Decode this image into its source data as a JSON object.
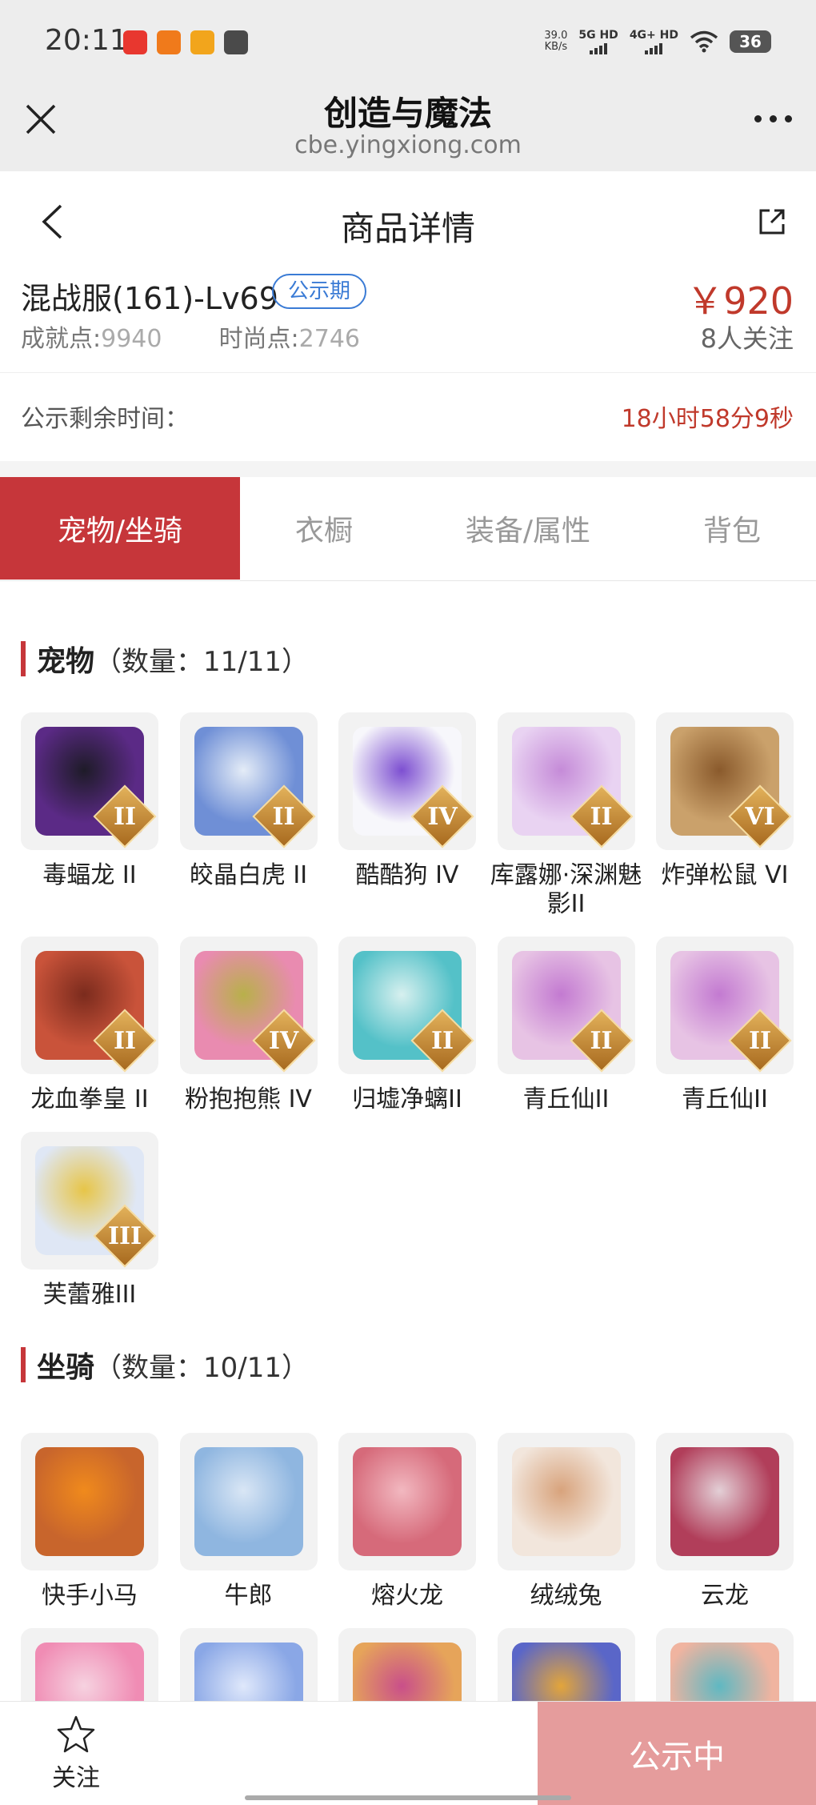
{
  "status_bar": {
    "time": "20:11",
    "net_speed_value": "39.0",
    "net_speed_unit": "KB/s",
    "signal_1": "5G HD",
    "signal_2": "4G+ HD",
    "battery": "36",
    "app_icon_colors": [
      "#e8372f",
      "#f07a1b",
      "#f2a51c",
      "#4a4a4a"
    ]
  },
  "browser": {
    "title": "创造与魔法",
    "url": "cbe.yingxiong.com"
  },
  "page": {
    "title": "商品详情"
  },
  "product": {
    "title": "混战服(161)-Lv69",
    "status_tag": "公示期",
    "achievement_label": "成就点:",
    "achievement_value": "9940",
    "fashion_label": "时尚点:",
    "fashion_value": "2746",
    "price": "￥920",
    "followers": "8人关注"
  },
  "countdown": {
    "label": "公示剩余时间：",
    "value": "18小时58分9秒"
  },
  "tabs": [
    {
      "label": "宠物/坐骑",
      "active": true
    },
    {
      "label": "衣橱",
      "active": false
    },
    {
      "label": "装备/属性",
      "active": false
    },
    {
      "label": "背包",
      "active": false
    }
  ],
  "pets_section": {
    "name": "宠物",
    "count": "（数量：11/11）",
    "items": [
      {
        "name": "毒蝠龙 II",
        "rank": "II",
        "color": "#5b2a86",
        "accent": "#1e1b28"
      },
      {
        "name": "皎晶白虎 II",
        "rank": "II",
        "color": "#6f8fd6",
        "accent": "#e4ecf7"
      },
      {
        "name": "酷酷狗 IV",
        "rank": "IV",
        "color": "#f7f7fb",
        "accent": "#7d4fd1"
      },
      {
        "name": "库露娜·深渊魅影II",
        "rank": "II",
        "color": "#e9d3f2",
        "accent": "#c58bd8"
      },
      {
        "name": "炸弹松鼠 VI",
        "rank": "VI",
        "color": "#caa16b",
        "accent": "#8a5a2c"
      },
      {
        "name": "龙血拳皇 II",
        "rank": "II",
        "color": "#c9533a",
        "accent": "#7b2b1d"
      },
      {
        "name": "粉抱抱熊 IV",
        "rank": "IV",
        "color": "#e98bb0",
        "accent": "#b8b04a"
      },
      {
        "name": "归墟净螭II",
        "rank": "II",
        "color": "#54c1c8",
        "accent": "#d7f0ef"
      },
      {
        "name": "青丘仙II",
        "rank": "II",
        "color": "#e7c3e4",
        "accent": "#c37ad1"
      },
      {
        "name": "青丘仙II",
        "rank": "II",
        "color": "#e7c3e4",
        "accent": "#c37ad1"
      },
      {
        "name": "芙蕾雅III",
        "rank": "III",
        "color": "#dfe7f5",
        "accent": "#e7c548"
      }
    ]
  },
  "mounts_section": {
    "name": "坐骑",
    "count": "（数量：10/11）",
    "items": [
      {
        "name": "快手小马",
        "color": "#c8652c",
        "accent": "#f08a1c"
      },
      {
        "name": "牛郎",
        "color": "#8fb6e0",
        "accent": "#d9e6f5"
      },
      {
        "name": "熔火龙",
        "color": "#d66a7a",
        "accent": "#f2b8c0"
      },
      {
        "name": "绒绒兔",
        "color": "#f2e6dc",
        "accent": "#d8a37c"
      },
      {
        "name": "云龙",
        "color": "#b13e5a",
        "accent": "#e3cfd6"
      },
      {
        "name": "",
        "color": "#f08cb4",
        "accent": "#f6d2e0"
      },
      {
        "name": "",
        "color": "#8aa7e6",
        "accent": "#dfe8fb"
      },
      {
        "name": "",
        "color": "#e6a45a",
        "accent": "#c94f8a"
      },
      {
        "name": "",
        "color": "#5a66c8",
        "accent": "#e3a53a"
      },
      {
        "name": "",
        "color": "#f0b4a0",
        "accent": "#5fb8c2"
      }
    ]
  },
  "bottom_bar": {
    "follow_label": "关注",
    "publicity_label": "公示中"
  }
}
